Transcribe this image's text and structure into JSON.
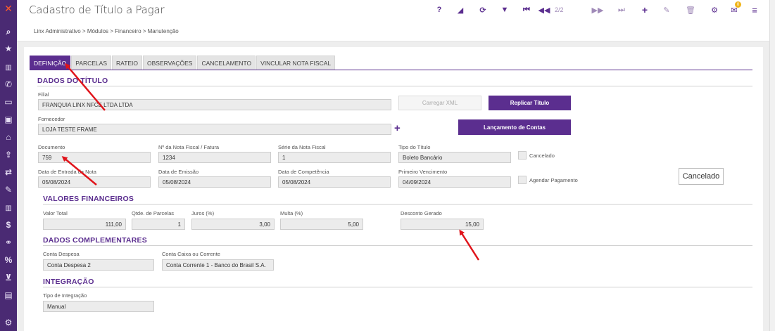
{
  "app": {
    "title": "Cadastro de Título a Pagar",
    "pager": "2/2",
    "notification_count": "0"
  },
  "colors": {
    "accent": "#5b2e8f",
    "sidebar": "#4a2a73",
    "arrow": "#e0141b",
    "badge": "#f0b419"
  },
  "sidebar": {
    "icons": [
      "x-logo-icon",
      "search-icon",
      "star-icon",
      "bar-chart-icon",
      "phone-icon",
      "monitor-icon",
      "calculator-icon",
      "bank-icon",
      "upload-icon",
      "exchange-icon",
      "tools-icon",
      "chart-icon",
      "dollar-icon",
      "group-icon",
      "percent-icon",
      "cart-icon",
      "card-icon",
      "cogs-icon"
    ]
  },
  "toolbar": {
    "icons": [
      "help-icon",
      "eraser-icon",
      "refresh-icon",
      "filter-icon",
      "first-page-icon",
      "prev-page-icon",
      "next-page-icon",
      "last-page-icon",
      "add-icon",
      "edit-icon",
      "delete-icon",
      "settings-icon",
      "notification-icon",
      "menu-icon"
    ]
  },
  "breadcrumb": "Linx Administrativo > Módulos > Financeiro > Manutenção",
  "tabs": [
    {
      "label": "DEFINIÇÃO",
      "active": true
    },
    {
      "label": "PARCELAS",
      "active": false
    },
    {
      "label": "RATEIO",
      "active": false
    },
    {
      "label": "OBSERVAÇÕES",
      "active": false
    },
    {
      "label": "CANCELAMENTO",
      "active": false
    },
    {
      "label": "VINCULAR NOTA FISCAL",
      "active": false
    }
  ],
  "dados_titulo": {
    "title": "DADOS DO TÍTULO",
    "filial_label": "Filial",
    "filial": "FRANQUIA LINX NFCE LTDA LTDA",
    "fornecedor_label": "Fornecedor",
    "fornecedor": "LOJA TESTE FRAME",
    "carregar_xml": "Carregar XML",
    "replicar_titulo": "Replicar Título",
    "lancamento_contas": "Lançamento de Contas",
    "documento_label": "Documento",
    "documento": "759",
    "nota_fiscal_label": "Nº da Nota Fiscal / Fatura",
    "nota_fiscal": "1234",
    "serie_label": "Série da Nota Fiscal",
    "serie": "1",
    "tipo_titulo_label": "Tipo do Título",
    "tipo_titulo": "Boleto Bancário",
    "cancelado_label": "Cancelado",
    "data_entrada_label": "Data de Entrada da Nota",
    "data_entrada": "05/08/2024",
    "data_emissao_label": "Data de Emissão",
    "data_emissao": "05/08/2024",
    "data_competencia_label": "Data de Competência",
    "data_competencia": "05/08/2024",
    "primeiro_vencimento_label": "Primeiro Vencimento",
    "primeiro_vencimento": "04/09/2024",
    "agendar_pagamento_label": "Agendar Pagamento",
    "status": "Cancelado"
  },
  "valores": {
    "title": "VALORES FINANCEIROS",
    "valor_total_label": "Valor Total",
    "valor_total": "111,00",
    "qtde_parcelas_label": "Qtde. de Parcelas",
    "qtde_parcelas": "1",
    "juros_label": "Juros (%)",
    "juros": "3,00",
    "multa_label": "Multa (%)",
    "multa": "5,00",
    "desconto_label": "Desconto Gerado",
    "desconto": "15,00"
  },
  "complementares": {
    "title": "DADOS COMPLEMENTARES",
    "conta_despesa_label": "Conta Despesa",
    "conta_despesa": "Conta Despesa 2",
    "conta_caixa_label": "Conta Caixa ou Corrente",
    "conta_caixa": "Conta Corrente 1 - Banco do Brasil S.A."
  },
  "integracao": {
    "title": "INTEGRAÇÃO",
    "tipo_label": "Tipo de Integração",
    "tipo": "Manual"
  }
}
